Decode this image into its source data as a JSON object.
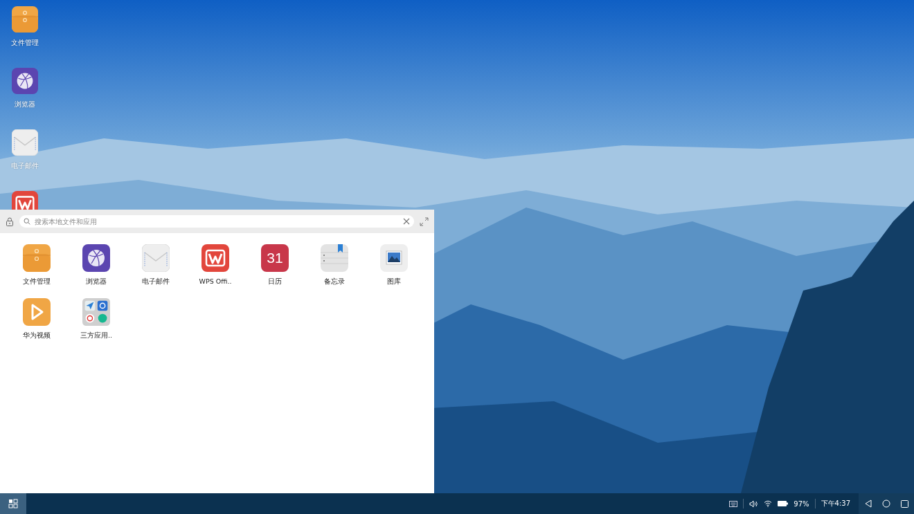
{
  "desktop_icons": [
    {
      "kind": "files",
      "label": "文件管理"
    },
    {
      "kind": "browser",
      "label": "浏览器"
    },
    {
      "kind": "mail",
      "label": "电子邮件"
    },
    {
      "kind": "wps"
    }
  ],
  "launcher": {
    "search": {
      "placeholder": "搜索本地文件和应用"
    },
    "apps": [
      {
        "kind": "files",
        "label": "文件管理"
      },
      {
        "kind": "browser",
        "label": "浏览器"
      },
      {
        "kind": "mail",
        "label": "电子邮件"
      },
      {
        "kind": "wps",
        "label": "WPS Offi.."
      },
      {
        "kind": "calendar",
        "label": "日历",
        "icon_text": "31"
      },
      {
        "kind": "notes",
        "label": "备忘录"
      },
      {
        "kind": "gallery",
        "label": "图库"
      },
      {
        "kind": "video",
        "label": "华为视频"
      },
      {
        "kind": "folder",
        "label": "三方应用.."
      }
    ]
  },
  "taskbar": {
    "battery": "97%",
    "time": "下午4:37"
  }
}
